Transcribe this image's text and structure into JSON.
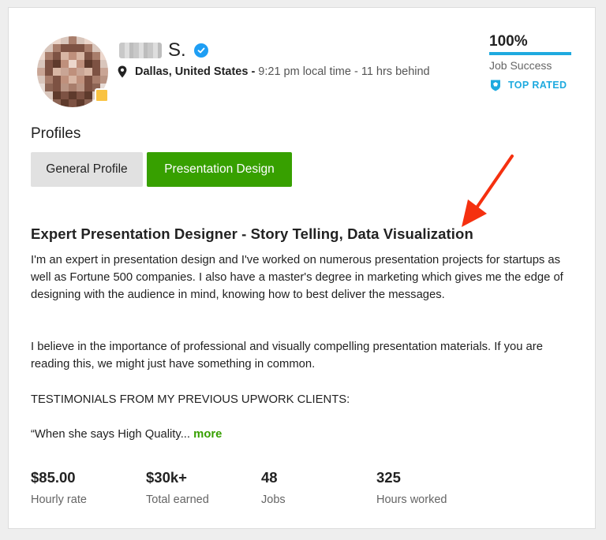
{
  "profile": {
    "name_suffix": "S.",
    "location": "Dallas, United States",
    "separator": "-",
    "local_time": "9:21 pm local time - 11 hrs behind",
    "job_success": {
      "value": "100%",
      "fraction": 1.0,
      "label": "Job Success"
    },
    "badge": "TOP RATED"
  },
  "profiles": {
    "title": "Profiles",
    "tabs": [
      {
        "label": "General Profile",
        "selected": false
      },
      {
        "label": "Presentation Design",
        "selected": true
      }
    ]
  },
  "overview": {
    "headline": "Expert Presentation Designer - Story Telling, Data Visualization",
    "paragraphs": [
      "I'm an expert in presentation design and I've worked on numerous presentation projects for startups as well as Fortune 500 companies. I also have a master's degree in marketing which gives me the edge of designing with the audience in mind, knowing how to best deliver the messages.",
      "I believe in the importance of professional and visually compelling presentation materials. If you are reading this, we might just have something in common.",
      "TESTIMONIALS FROM MY PREVIOUS UPWORK CLIENTS:",
      "“When she says High Quality..."
    ],
    "more_label": "more"
  },
  "stats": [
    {
      "value": "$85.00",
      "label": "Hourly rate"
    },
    {
      "value": "$30k+",
      "label": "Total earned"
    },
    {
      "value": "48",
      "label": "Jobs"
    },
    {
      "value": "325",
      "label": "Hours worked"
    }
  ],
  "colors": {
    "accent_green": "#37a000",
    "accent_blue": "#1eaadf",
    "verified_blue": "#1e9ef4",
    "annotation_red": "#f5300f"
  },
  "icons": {
    "verified": "verified-check-icon",
    "location": "map-pin-icon",
    "top_rated": "shield-icon",
    "annotation": "red-arrow-icon"
  }
}
